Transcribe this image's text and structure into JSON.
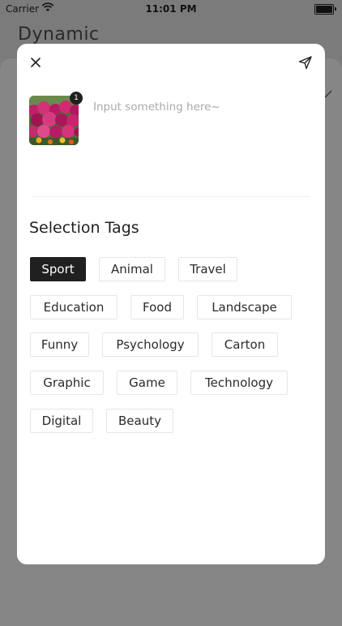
{
  "status_bar": {
    "carrier": "Carrier",
    "time": "11:01 PM"
  },
  "background": {
    "title": "Dynamic"
  },
  "modal": {
    "image_count": "1",
    "input_placeholder": "Input something here~",
    "section_title": "Selection Tags",
    "tags": [
      {
        "label": "Sport",
        "selected": true
      },
      {
        "label": "Animal",
        "selected": false
      },
      {
        "label": "Travel",
        "selected": false
      },
      {
        "label": "Education",
        "selected": false
      },
      {
        "label": "Food",
        "selected": false
      },
      {
        "label": "Landscape",
        "selected": false
      },
      {
        "label": "Funny",
        "selected": false
      },
      {
        "label": "Psychology",
        "selected": false
      },
      {
        "label": "Carton",
        "selected": false
      },
      {
        "label": "Graphic",
        "selected": false
      },
      {
        "label": "Game",
        "selected": false
      },
      {
        "label": "Technology",
        "selected": false
      },
      {
        "label": "Digital",
        "selected": false
      },
      {
        "label": "Beauty",
        "selected": false
      }
    ],
    "icons": {
      "close": "close-icon",
      "send": "send-icon"
    }
  }
}
